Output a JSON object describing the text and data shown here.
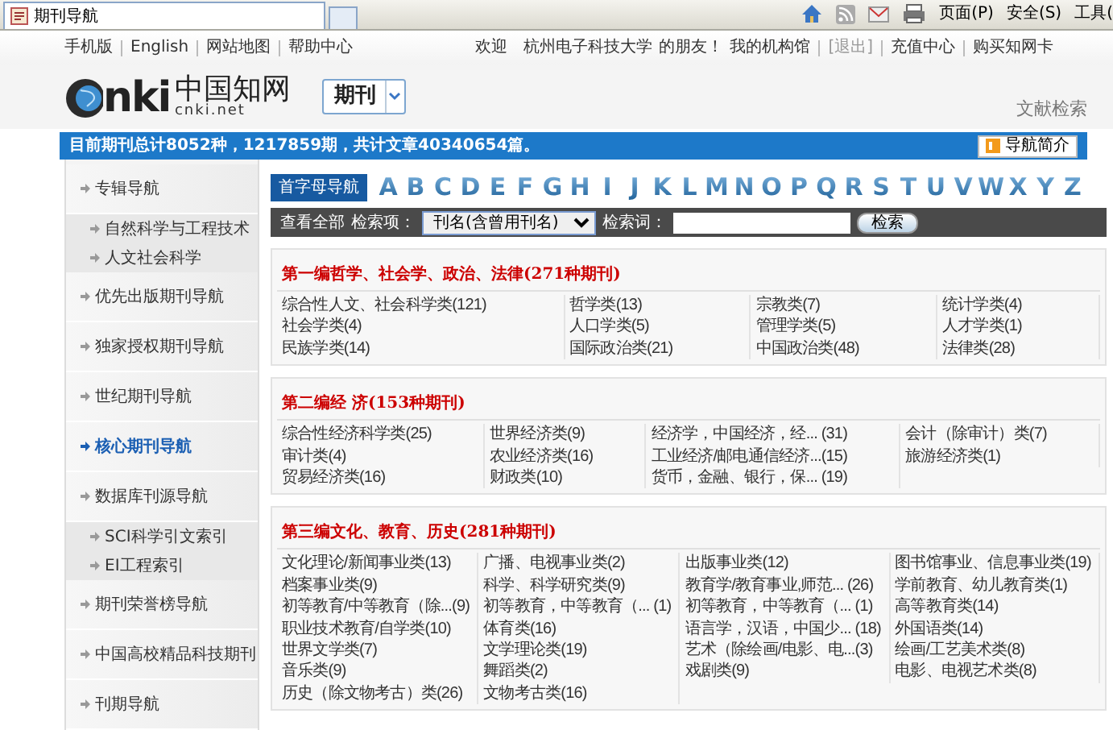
{
  "browser": {
    "tab_title": "期刊导航",
    "toolbar": [
      "页面(P)",
      "安全(S)",
      "工具("
    ]
  },
  "top_links": {
    "left": [
      "手机版",
      "English",
      "网站地图",
      "帮助中心"
    ],
    "welcome": "欢迎",
    "org": "杭州电子科技大学",
    "friend": "的朋友！",
    "right": [
      {
        "label": "我的机构馆",
        "disabled": false
      },
      {
        "label": "[退出]",
        "disabled": true
      },
      {
        "label": "充值中心",
        "disabled": false
      },
      {
        "label": "购买知网卡",
        "disabled": false
      }
    ]
  },
  "logo": {
    "wordmark": "nki",
    "chinese": "中国知网",
    "domain": "cnki.net"
  },
  "product": "期刊",
  "search_link": "文献检索",
  "stats": "目前期刊总计8052种，1217859期，共计文章40340654篇。",
  "intro_button": "导航简介",
  "sidebar": [
    {
      "label": "专辑导航",
      "kind": "main",
      "selected": false
    },
    {
      "label": "自然科学与工程技术",
      "kind": "sub",
      "selected": false
    },
    {
      "label": "人文社会科学",
      "kind": "sub",
      "selected": false
    },
    {
      "label": "优先出版期刊导航",
      "kind": "main",
      "selected": false
    },
    {
      "label": "独家授权期刊导航",
      "kind": "main",
      "selected": false
    },
    {
      "label": "世纪期刊导航",
      "kind": "main",
      "selected": false
    },
    {
      "label": "核心期刊导航",
      "kind": "main",
      "selected": true
    },
    {
      "label": "数据库刊源导航",
      "kind": "main",
      "selected": false
    },
    {
      "label": "SCI科学引文索引",
      "kind": "sub",
      "selected": false
    },
    {
      "label": "EI工程索引",
      "kind": "sub",
      "selected": false
    },
    {
      "label": "期刊荣誉榜导航",
      "kind": "main",
      "selected": false
    },
    {
      "label": "中国高校精品科技期刊",
      "kind": "main",
      "selected": false
    },
    {
      "label": "刊期导航",
      "kind": "main",
      "selected": false
    }
  ],
  "letter_nav": {
    "label": "首字母导航",
    "letters": [
      "A",
      "B",
      "C",
      "D",
      "E",
      "F",
      "G",
      "H",
      "I",
      "J",
      "K",
      "L",
      "M",
      "N",
      "O",
      "P",
      "Q",
      "R",
      "S",
      "T",
      "U",
      "V",
      "W",
      "X",
      "Y",
      "Z"
    ]
  },
  "search": {
    "view_all": "查看全部",
    "field_label": "检索项：",
    "field_value": "刊名(含曾用刊名)",
    "term_label": "检索词：",
    "button": "检索"
  },
  "sections": [
    {
      "title": "第一编哲学、社会学、政治、法律(271种期刊)",
      "items": [
        "综合性人文、社会科学类(121)",
        "哲学类(13)",
        "宗教类(7)",
        "统计学类(4)",
        "社会学类(4)",
        "人口学类(5)",
        "管理学类(5)",
        "人才学类(1)",
        "民族学类(14)",
        "国际政治类(21)",
        "中国政治类(48)",
        "法律类(28)"
      ]
    },
    {
      "title": "第二编经  济(153种期刊)",
      "items": [
        "综合性经济科学类(25)",
        "世界经济类(9)",
        "经济学，中国经济，经... (31)",
        "会计（除审计）类(7)",
        "审计类(4)",
        "农业经济类(16)",
        "工业经济/邮电通信经济...(15)",
        "旅游经济类(1)",
        "贸易经济类(16)",
        "财政类(10)",
        "货币，金融、银行，保... (19)"
      ]
    },
    {
      "title": "第三编文化、教育、历史(281种期刊)",
      "items": [
        "文化理论/新闻事业类(13)",
        "广播、电视事业类(2)",
        "出版事业类(12)",
        "图书馆事业、信息事业类(19)",
        "档案事业类(9)",
        "科学、科学研究类(9)",
        "教育学/教育事业,师范... (26)",
        "学前教育、幼儿教育类(1)",
        "初等教育/中等教育（除...(9)",
        "初等教育，中等教育（... (1)",
        "初等教育，中等教育（... (1)",
        "高等教育类(14)",
        "职业技术教育/自学类(10)",
        "体育类(16)",
        "语言学，汉语，中国少... (18)",
        "外国语类(14)",
        "世界文学类(7)",
        "文学理论类(19)",
        "艺术（除绘画/电影、电...(3)",
        "绘画/工艺美术类(8)",
        "音乐类(9)",
        "舞蹈类(2)",
        "戏剧类(9)",
        "电影、电视艺术类(8)",
        "历史（除文物考古）类(26)",
        "文物考古类(16)"
      ]
    }
  ]
}
